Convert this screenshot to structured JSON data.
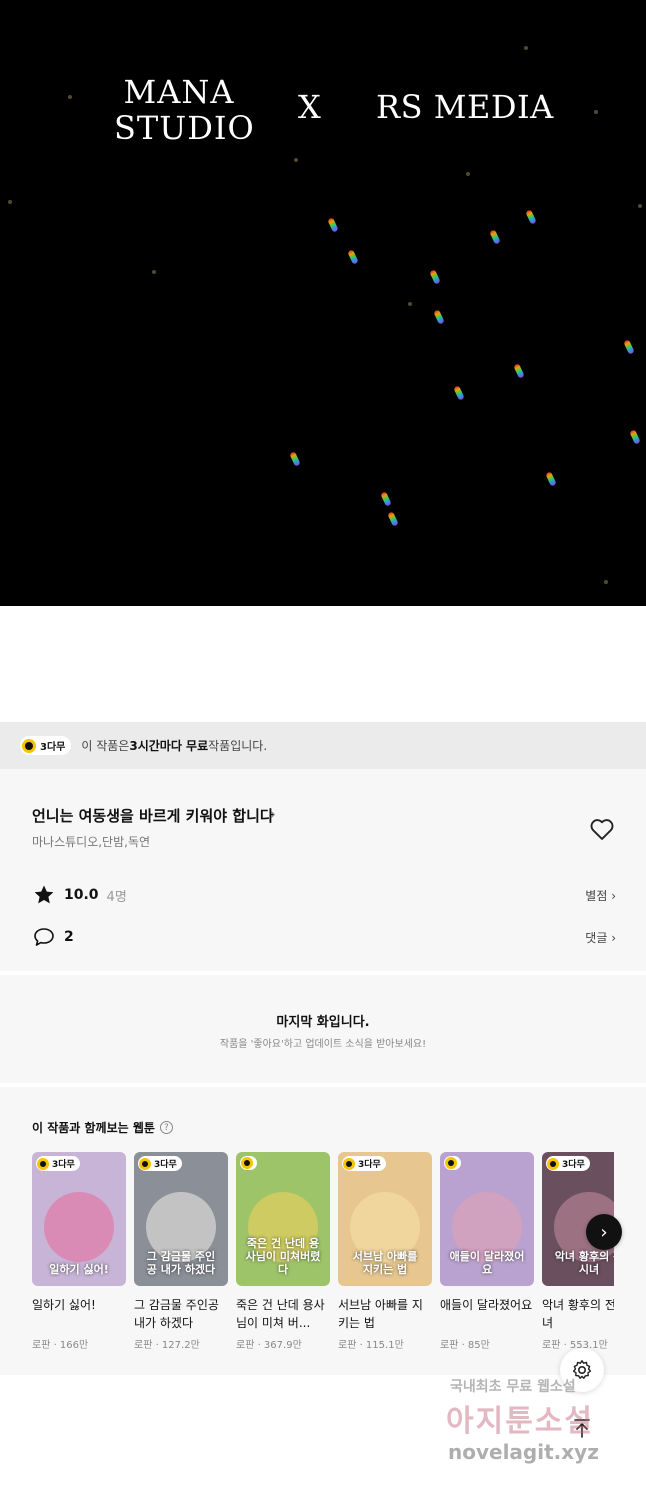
{
  "banner": {
    "logo_left_line1": "MANA",
    "logo_left_line2": "STUDIO",
    "logo_x": "X",
    "logo_right": "RS MEDIA"
  },
  "free_notice": {
    "badge": "3다무",
    "text_pre": "이 작품은 ",
    "text_bold": "3시간마다 무료",
    "text_post": " 작품입니다."
  },
  "work": {
    "title": "언니는 여동생을 바르게 키워야 합니다",
    "title_chevron": "›",
    "authors": "마나스튜디오,단밤,독연",
    "rating": "10.0",
    "rating_count": "4명",
    "rating_link": "별점 ›",
    "comments": "2",
    "comments_link": "댓글 ›"
  },
  "last_episode": {
    "heading": "마지막 화입니다.",
    "subtext": "작품을 '좋아요'하고 업데이트 소식을 받아보세요!"
  },
  "recommend": {
    "title": "이 작품과 함께보는 웹툰",
    "help": "?",
    "next_icon": "›",
    "items": [
      {
        "badge": "3다무",
        "name": "일하기 싫어!",
        "meta": "로판 · 166만",
        "cap": "일하기 싫어!",
        "bg": "#c8b4d6",
        "art": "#e86a9a"
      },
      {
        "badge": "3다무",
        "name": "그 감금물 주인공 내가 하겠다",
        "meta": "로판 · 127.2만",
        "cap": "그 감금물 주인공 내가 하겠다",
        "bg": "#8a8f98",
        "art": "#f2efe8"
      },
      {
        "badge": "",
        "name": "죽은 건 난데 용사님이 미쳐 버...",
        "meta": "로판 · 367.9만",
        "cap": "죽은 건 난데 용사님이 미쳐버렸다",
        "bg": "#9ec46a",
        "art": "#f4d25a"
      },
      {
        "badge": "3다무",
        "name": "서브남 아빠를 지키는 법",
        "meta": "로판 · 115.1만",
        "cap": "서브남 아빠를 지키는 법",
        "bg": "#e7c78f",
        "art": "#f7e0a8"
      },
      {
        "badge": "",
        "name": "애들이 달라졌어요",
        "meta": "로판 · 85만",
        "cap": "애들이 달라졌어요",
        "bg": "#b9a2cf",
        "art": "#e6a0b4"
      },
      {
        "badge": "3다무",
        "name": "악녀 황후의 전 시녀",
        "meta": "로판 · 553.1만",
        "cap": "악녀 황후의 전 시녀",
        "bg": "#6a4f5e",
        "art": "#c58fa0"
      }
    ]
  },
  "watermark": {
    "line1": "국내최초 무료 웹소설",
    "line2": "아지툰소설",
    "line3": "novelagit.xyz"
  },
  "colors": {
    "accent_yellow": "#f6c400",
    "panel_bg": "#f7f7f7",
    "notice_bg": "#ebebeb"
  }
}
